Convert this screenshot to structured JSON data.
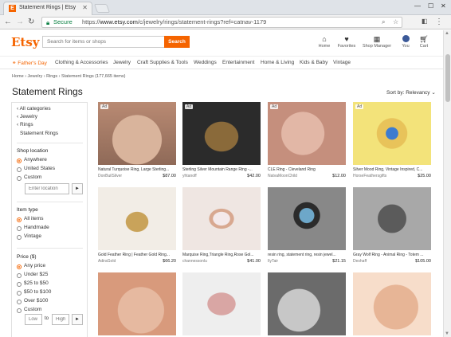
{
  "browser": {
    "tab_title": "Statement Rings | Etsy",
    "tab_favicon": "E",
    "secure_label": "Secure",
    "url_prefix": "https://",
    "url_host": "www.etsy.com",
    "url_path": "/c/jewelry/rings/statement-rings?ref=catnav-1179"
  },
  "header": {
    "logo": "Etsy",
    "search_placeholder": "Search for items or shops",
    "search_button": "Search",
    "nav": [
      {
        "label": "Home",
        "icon": "home-icon"
      },
      {
        "label": "Favorites",
        "icon": "heart-icon"
      },
      {
        "label": "Shop Manager",
        "icon": "shop-icon"
      },
      {
        "label": "You",
        "icon": "avatar"
      },
      {
        "label": "Cart",
        "icon": "cart-icon"
      }
    ]
  },
  "categories": [
    "Father's Day",
    "Clothing & Accessories",
    "Jewelry",
    "Craft Supplies & Tools",
    "Weddings",
    "Entertainment",
    "Home & Living",
    "Kids & Baby",
    "Vintage"
  ],
  "breadcrumb": "Home › Jewelry › Rings › Statement Rings (177,665 items)",
  "page_title": "Statement Rings",
  "sort_label": "Sort by: Relevancy",
  "sidebar": {
    "cat_links": [
      "All categories",
      "Jewelry",
      "Rings"
    ],
    "current_cat": "Statement Rings",
    "shop_location": {
      "heading": "Shop location",
      "options": [
        "Anywhere",
        "United States",
        "Custom"
      ],
      "selected": "Anywhere",
      "location_placeholder": "Enter location"
    },
    "item_type": {
      "heading": "Item type",
      "options": [
        "All items",
        "Handmade",
        "Vintage"
      ],
      "selected": "All items"
    },
    "price": {
      "heading": "Price ($)",
      "options": [
        "Any price",
        "Under $25",
        "$25 to $50",
        "$50 to $100",
        "Over $100",
        "Custom"
      ],
      "selected": "Any price",
      "low_placeholder": "Low",
      "to_label": "to",
      "high_placeholder": "High"
    },
    "go_glyph": "►"
  },
  "listings": [
    {
      "title": "Natural Turquoise Ring, Large Sterling...",
      "shop": "DonBuilSilver",
      "price": "$87.00",
      "ad": "Ad"
    },
    {
      "title": "Sterling Silver Mountain Range Ring -...",
      "shop": "yhtanoff",
      "price": "$42.00",
      "ad": "Ad"
    },
    {
      "title": "CLE Ring - Cleveland Ring",
      "shop": "NatvaMoonChild",
      "price": "$12.00",
      "ad": "Ad"
    },
    {
      "title": "Silver Mood Ring, Vintage Inspired, C...",
      "shop": "HorseFeathersgifts",
      "price": "$25.00",
      "ad": "Ad"
    },
    {
      "title": "Gold Feather Ring | Feather Gold Ring...",
      "shop": "AdiraGold",
      "price": "$66.20",
      "ad": ""
    },
    {
      "title": "Marquise Ring,Triangle Ring,Rose Gol...",
      "shop": "channessonlu",
      "price": "$41.00",
      "ad": ""
    },
    {
      "title": "resin ring, statement ring, resin jewel...",
      "shop": "IlyTair",
      "price": "$21.15",
      "ad": ""
    },
    {
      "title": "Gray Wolf Ring - Animal Ring - Totem ...",
      "shop": "Deshaff",
      "price": "$105.00",
      "ad": ""
    },
    {
      "title": "",
      "shop": "",
      "price": "",
      "ad": ""
    },
    {
      "title": "",
      "shop": "",
      "price": "",
      "ad": ""
    },
    {
      "title": "",
      "shop": "",
      "price": "",
      "ad": ""
    },
    {
      "title": "",
      "shop": "",
      "price": "",
      "ad": ""
    }
  ],
  "colors": {
    "brand": "#f56400",
    "secure": "#0b8043"
  }
}
